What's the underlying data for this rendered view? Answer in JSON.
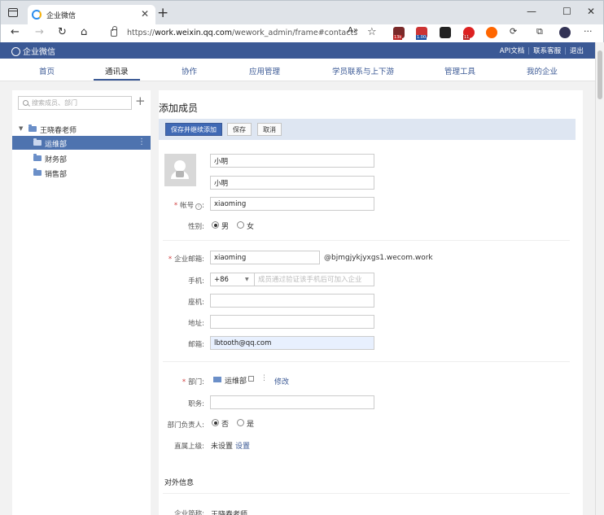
{
  "browser": {
    "tab_title": "企业微信",
    "url_prefix": "https://",
    "url_host": "work.weixin.qq.com",
    "url_path": "/wework_admin/frame#contacts",
    "ext_badges": [
      "13k",
      "1.00",
      "11"
    ]
  },
  "app": {
    "logo": "企业微信",
    "links": [
      "API文档",
      "联系客服",
      "退出"
    ]
  },
  "nav": [
    "首页",
    "通讯录",
    "协作",
    "应用管理",
    "学员联系与上下游",
    "管理工具",
    "我的企业"
  ],
  "sidebar": {
    "search_placeholder": "搜索成员、部门",
    "root": "王晓春老师",
    "departments": [
      "运维部",
      "财务部",
      "销售部"
    ]
  },
  "form": {
    "title": "添加成员",
    "buttons": [
      "保存并继续添加",
      "保存",
      "取消"
    ],
    "name": "小明",
    "alias": "小明",
    "account_label": "帐号",
    "account": "xiaoming",
    "gender_label": "性别:",
    "gender_options": [
      "男",
      "女"
    ],
    "email_label": "企业邮箱:",
    "email_local": "xiaoming",
    "email_domain": "@bjmgjykjyxgs1.wecom.work",
    "phone_label": "手机:",
    "country_code": "+86",
    "phone_placeholder": "成员通过验证该手机后可加入企业",
    "tel_label": "座机:",
    "address_label": "地址:",
    "mail_label": "邮箱:",
    "mail": "lbtooth@qq.com",
    "dept_label": "部门:",
    "dept_value": "运维部",
    "dept_edit": "修改",
    "position_label": "职务:",
    "leader_label": "部门负责人:",
    "leader_options": [
      "否",
      "是"
    ],
    "superior_label": "直属上级:",
    "superior_value": "未设置",
    "superior_set": "设置",
    "external_title": "对外信息",
    "corp_name_label": "企业简称:",
    "corp_name": "王晓春老师"
  }
}
